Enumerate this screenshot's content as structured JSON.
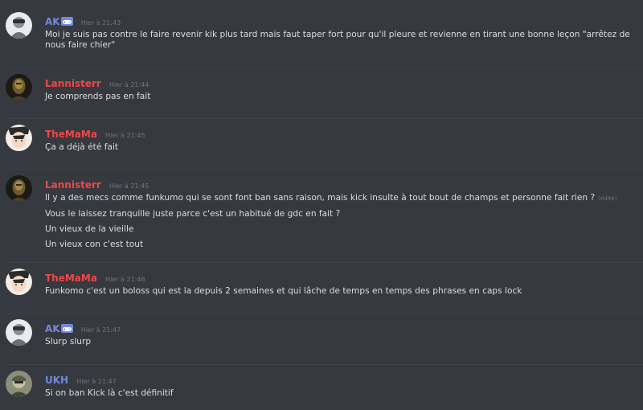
{
  "colors": {
    "background": "#36393f",
    "text": "#dcddde",
    "muted": "#72767d",
    "name_blue": "#7289da",
    "name_red": "#f04747"
  },
  "messages": [
    {
      "author": "AK",
      "author_color": "#7289da",
      "badge": "controller-badge-icon",
      "timestamp": "Hier à 21:43",
      "lines": [
        {
          "text": "Moi je suis pas contre le faire revenir kik plus tard mais faut taper fort pour qu'il pleure et revienne en tirant une bonne leçon \"arrêtez de nous faire chier\""
        }
      ]
    },
    {
      "author": "Lannisterr",
      "author_color": "#f04747",
      "timestamp": "Hier à 21:44",
      "lines": [
        {
          "text": "Je comprends pas en fait"
        }
      ]
    },
    {
      "author": "TheMaMa",
      "author_color": "#f04747",
      "timestamp": "Hier à 21:45",
      "lines": [
        {
          "text": "Ça a déjà été fait"
        }
      ]
    },
    {
      "author": "Lannisterr",
      "author_color": "#f04747",
      "timestamp": "Hier à 21:45",
      "lines": [
        {
          "text": "Il y a des mecs comme funkumo qui se sont font ban sans raison, mais kick insulte à tout bout de champs et personne fait rien ?",
          "edited": "(édité)"
        },
        {
          "text": "Vous le laissez tranquille juste parce c'est un habitué de gdc en fait ?"
        },
        {
          "text": "Un vieux de la vieille"
        },
        {
          "text": "Un vieux con c'est tout"
        }
      ]
    },
    {
      "author": "TheMaMa",
      "author_color": "#f04747",
      "timestamp": "Hier à 21:46",
      "lines": [
        {
          "text": "Funkomo c'est un boloss qui est la depuis 2 semaines et qui lâche de temps en temps des phrases en caps lock"
        }
      ]
    },
    {
      "author": "AK",
      "author_color": "#7289da",
      "badge": "controller-badge-icon",
      "timestamp": "Hier à 21:47",
      "lines": [
        {
          "text": "Slurp slurp"
        }
      ]
    },
    {
      "author": "UKH",
      "author_color": "#7289da",
      "timestamp": "Hier à 21:47",
      "lines": [
        {
          "text": "Si on ban Kick là c'est définitif"
        }
      ]
    }
  ]
}
